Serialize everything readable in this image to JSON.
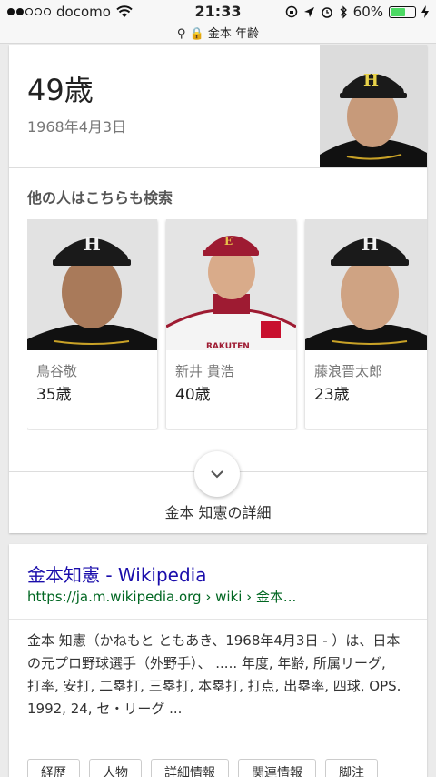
{
  "status_bar": {
    "carrier": "docomo",
    "time": "21:33",
    "battery": "60%",
    "battery_level": 0.6,
    "url": "金本 年齢"
  },
  "age_card": {
    "age": "49歳",
    "birthdate": "1968年4月3日",
    "people_also_search_title": "他の人はこちらも検索",
    "people": [
      {
        "name": "鳥谷敬",
        "age": "35歳"
      },
      {
        "name": "新井 貴浩",
        "age": "40歳"
      },
      {
        "name": "藤浪晋太郎",
        "age": "23歳"
      }
    ],
    "details_label": "金本 知憲の詳細"
  },
  "wiki_result": {
    "title": "金本知憲 - Wikipedia",
    "url": "https://ja.m.wikipedia.org › wiki › 金本...",
    "snippet": "金本 知憲（かねもと ともあき、1968年4月3日 - ）は、日本の元プロ野球選手（外野手）、 ..... 年度, 年齢, 所属リーグ, 打率, 安打, 二塁打, 三塁打, 本塁打, 打点, 出塁率, 四球, OPS. 1992, 24, セ・リーグ ...",
    "chips": [
      "経歴",
      "人物",
      "詳細情報",
      "関連情報",
      "脚注"
    ]
  },
  "colors": {
    "tigers_cap": "#1a1a1a",
    "eagles_cap": "#9e1b32",
    "link": "#1a0dab",
    "url_green": "#006621"
  }
}
